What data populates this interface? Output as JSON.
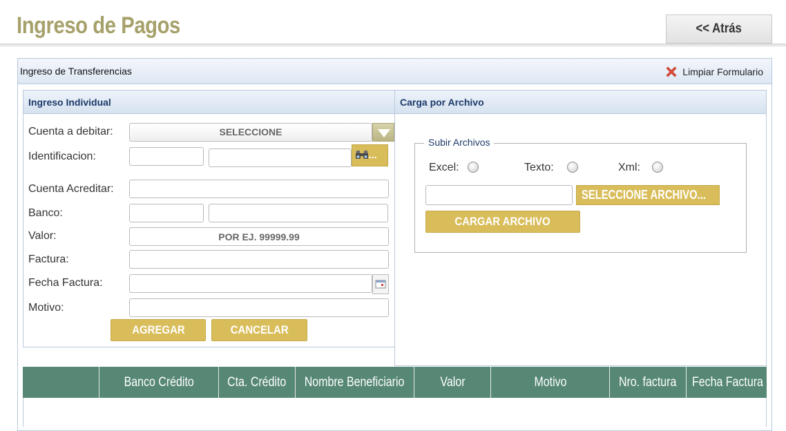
{
  "page": {
    "title": "Ingreso de Pagos",
    "back_label": "<< Atrás"
  },
  "panel": {
    "title": "Ingreso de Transferencias",
    "clear_label": "Limpiar Formulario"
  },
  "individual": {
    "header": "Ingreso Individual",
    "labels": {
      "cuenta_debitar": "Cuenta a debitar:",
      "identificacion": "Identificacion:",
      "cuenta_acreditar": "Cuenta Acreditar:",
      "banco": "Banco:",
      "valor": "Valor:",
      "factura": "Factura:",
      "fecha_factura": "Fecha Factura:",
      "motivo": "Motivo:"
    },
    "cuenta_select_value": "SELECCIONE",
    "search_button_label": "...",
    "valor_placeholder": "POR EJ. 99999.99",
    "add_label": "AGREGAR",
    "cancel_label": "CANCELAR"
  },
  "file_upload": {
    "header": "Carga por Archivo",
    "legend": "Subir Archivos",
    "options": [
      "Excel:",
      "Texto:",
      "Xml:"
    ],
    "select_file_label": "SELECCIONE ARCHIVO...",
    "upload_label": "CARGAR ARCHIVO"
  },
  "table": {
    "columns": [
      "",
      "Banco Crédito",
      "Cta. Crédito",
      "Nombre Beneficiario",
      "Valor",
      "Motivo",
      "Nro. factura",
      "Fecha Factura"
    ]
  },
  "colors": {
    "title": "#a6a16a",
    "gold_button": "#d9bd5a",
    "table_header": "#578876",
    "section_title": "#1d3a6a"
  }
}
